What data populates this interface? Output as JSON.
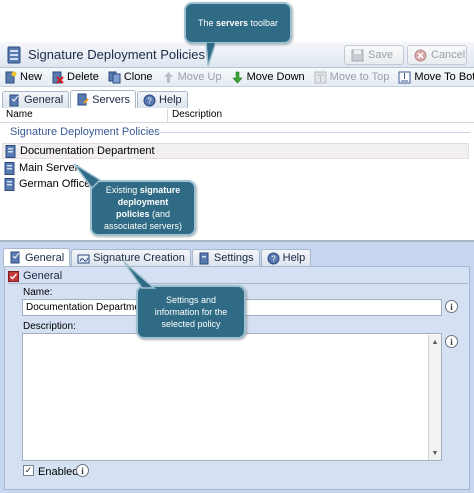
{
  "callouts": {
    "toolbar": {
      "pre": "The ",
      "bold": "servers",
      "post": " toolbar"
    },
    "policies": {
      "pre": "Existing ",
      "bold": "signature deployment policies",
      "post": " (and associated servers)"
    },
    "settings": {
      "text": "Settings and information for the selected policy"
    }
  },
  "window": {
    "title": "Signature Deployment Policies",
    "save_label": "Save",
    "cancel_label": "Cancel"
  },
  "toolbar": {
    "new": "New",
    "delete": "Delete",
    "clone": "Clone",
    "move_up": "Move Up",
    "move_down": "Move Down",
    "move_to_top": "Move to Top",
    "move_to_bottom": "Move To Bottom"
  },
  "top_tabs": [
    "General",
    "Servers",
    "Help"
  ],
  "list": {
    "columns": [
      "Name",
      "Description"
    ],
    "group_title": "Signature Deployment Policies",
    "rows": [
      "Documentation Department",
      "Main Server",
      "German Office"
    ]
  },
  "bottom_tabs": [
    "General",
    "Signature Creation",
    "Settings",
    "Help"
  ],
  "general_section": {
    "header": "General",
    "name_label": "Name:",
    "name_value": "Documentation Department",
    "description_label": "Description:",
    "description_value": "",
    "enabled_label": "Enabled",
    "enabled": true
  },
  "colors": {
    "callout_bg": "#2f6b84",
    "panel_bg": "#c6d6ef",
    "accent_text": "#3a5a96"
  }
}
